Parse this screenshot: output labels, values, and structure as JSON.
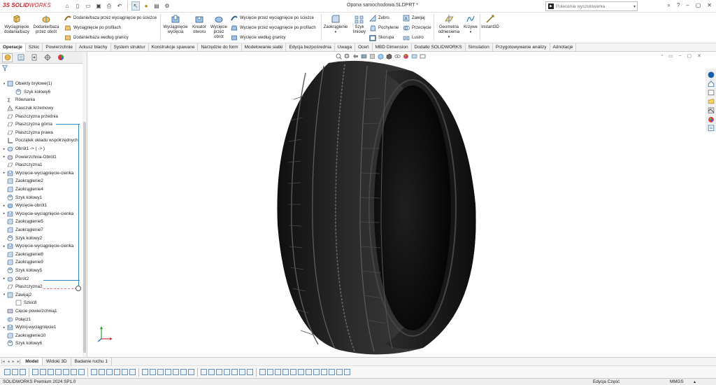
{
  "titlebar": {
    "logo_ds": "3S",
    "logo_solid": "SOLID",
    "logo_works": "WORKS",
    "document_title": "Opona samochodowa.SLDPRT *",
    "search_placeholder": "Polecenia wyszukiwania"
  },
  "ribbon": {
    "features": {
      "extrude_boss": "Wyciągnięcie dodania/bazy",
      "revolve_boss": "Dodanie/baza przez obrót",
      "swept_boss": "Dodanie/baza przez wyciągnięcie po ścieżce",
      "lofted_boss": "Wyciągnięcie po profilach",
      "boundary_boss": "Dodanie/baza według granicy",
      "extrude_cut": "Wyciągnięcie wycięcia",
      "hole_wizard": "Kreator otworu",
      "revolve_cut": "Wycięcie przez obrót",
      "swept_cut": "Wycięcie przez wyciągnięcie po ścieżce",
      "lofted_cut": "Wycięcie przez wyciągnięcie po profilach",
      "boundary_cut": "Wycięcie według granicy",
      "fillet": "Zaokrąglenie",
      "linear_pattern": "Szyk liniowy",
      "rib": "Żebro",
      "draft": "Pochylenie",
      "shell": "Skorupa",
      "wrap": "Zawijaj",
      "intersect": "Przecięcie",
      "mirror": "Lustro",
      "ref_geometry": "Geometria odniesienia",
      "curves": "Krzywe",
      "instant3d": "Instant3D"
    }
  },
  "command_tabs": [
    "Operacje",
    "Szkic",
    "Powierzchnie",
    "Arkusz blachy",
    "System struktur",
    "Konstrukcje spawane",
    "Narzędzie do form",
    "Modelowanie siatki",
    "Edycja bezpośrednia",
    "Uwaga",
    "Oceń",
    "MBD Dimension",
    "Dodatki SOLIDWORKS",
    "Simulation",
    "Przygotowywanie analizy",
    "Adnotacje"
  ],
  "tree": [
    {
      "label": "Obiekty bryłowe(1)",
      "indent": 0,
      "expander": "▾",
      "icon": "solid-bodies-icon"
    },
    {
      "label": "Szyk kołowy6",
      "indent": 1,
      "expander": "",
      "icon": "circular-pattern-icon"
    },
    {
      "label": "Równania",
      "indent": 0,
      "expander": "",
      "icon": "equations-icon"
    },
    {
      "label": "Kauczuk krzemowy",
      "indent": 0,
      "expander": "",
      "icon": "material-icon"
    },
    {
      "label": "Płaszczyzna przednia",
      "indent": 0,
      "expander": "",
      "icon": "plane-icon"
    },
    {
      "label": "Płaszczyzna górna",
      "indent": 0,
      "expander": "",
      "icon": "plane-icon"
    },
    {
      "label": "Płaszczyzna prawa",
      "indent": 0,
      "expander": "",
      "icon": "plane-icon"
    },
    {
      "label": "Początek układu współrzędnych",
      "indent": 0,
      "expander": "",
      "icon": "origin-icon"
    },
    {
      "label": "Obrót1 -> ( -> )",
      "indent": 0,
      "expander": "▸",
      "icon": "revolve-icon"
    },
    {
      "label": "Powierzchnia-Obrót1",
      "indent": 0,
      "expander": "▸",
      "icon": "surface-revolve-icon"
    },
    {
      "label": "Płaszczyzna1",
      "indent": 0,
      "expander": "",
      "icon": "plane-icon"
    },
    {
      "label": "Wycięcie-wyciągnięcie-cienka",
      "indent": 0,
      "expander": "▸",
      "icon": "extrude-cut-icon"
    },
    {
      "label": "Zaokrąglenie2",
      "indent": 0,
      "expander": "",
      "icon": "fillet-icon"
    },
    {
      "label": "Zaokrąglenie4",
      "indent": 0,
      "expander": "",
      "icon": "fillet-icon"
    },
    {
      "label": "Szyk kołowy1",
      "indent": 0,
      "expander": "",
      "icon": "circular-pattern-icon"
    },
    {
      "label": "Wycięcie-obrót1",
      "indent": 0,
      "expander": "▸",
      "icon": "revolve-cut-icon"
    },
    {
      "label": "Wycięcie-wyciągnięcie-cienka",
      "indent": 0,
      "expander": "▸",
      "icon": "extrude-cut-icon"
    },
    {
      "label": "Zaokrąglenie5",
      "indent": 0,
      "expander": "",
      "icon": "fillet-icon"
    },
    {
      "label": "Zaokrąglenie7",
      "indent": 0,
      "expander": "",
      "icon": "fillet-icon"
    },
    {
      "label": "Szyk kołowy2",
      "indent": 0,
      "expander": "",
      "icon": "circular-pattern-icon"
    },
    {
      "label": "Wycięcie-wyciągnięcie-cienka",
      "indent": 0,
      "expander": "▸",
      "icon": "extrude-cut-icon"
    },
    {
      "label": "Zaokrąglenie8",
      "indent": 0,
      "expander": "",
      "icon": "fillet-icon"
    },
    {
      "label": "Zaokrąglenie9",
      "indent": 0,
      "expander": "",
      "icon": "fillet-icon"
    },
    {
      "label": "Szyk kołowy5",
      "indent": 0,
      "expander": "",
      "icon": "circular-pattern-icon"
    },
    {
      "label": "Obrót2",
      "indent": 0,
      "expander": "▸",
      "icon": "revolve-icon"
    },
    {
      "label": "Płaszczyzna2",
      "indent": 0,
      "expander": "",
      "icon": "plane-icon"
    },
    {
      "label": "Zawijaj2",
      "indent": 0,
      "expander": "▾",
      "icon": "wrap-icon"
    },
    {
      "label": "Szkic8",
      "indent": 1,
      "expander": "",
      "icon": "sketch-icon"
    },
    {
      "label": "Cięcie powierzchnią1",
      "indent": 0,
      "expander": "",
      "icon": "surface-cut-icon"
    },
    {
      "label": "Połącz1",
      "indent": 0,
      "expander": "",
      "icon": "combine-icon"
    },
    {
      "label": "Wytnij-wyciągnięcie1",
      "indent": 0,
      "expander": "▸",
      "icon": "extrude-cut-icon"
    },
    {
      "label": "Zaokrąglenie10",
      "indent": 0,
      "expander": "",
      "icon": "fillet-icon"
    },
    {
      "label": "Szyk kołowy6",
      "indent": 0,
      "expander": "",
      "icon": "circular-pattern-icon"
    }
  ],
  "bottom_tabs": [
    "Model",
    "Widoki 3D",
    "Badanie ruchu 1"
  ],
  "statusbar": {
    "product": "SOLIDWORKS Premium 2024 SP1.0",
    "mode": "Edycja Część",
    "units": "MMGS"
  },
  "colors": {
    "accent_blue": "#2e86c1",
    "logo_red": "#d2232a",
    "tire_dark": "#1b1b1b"
  }
}
